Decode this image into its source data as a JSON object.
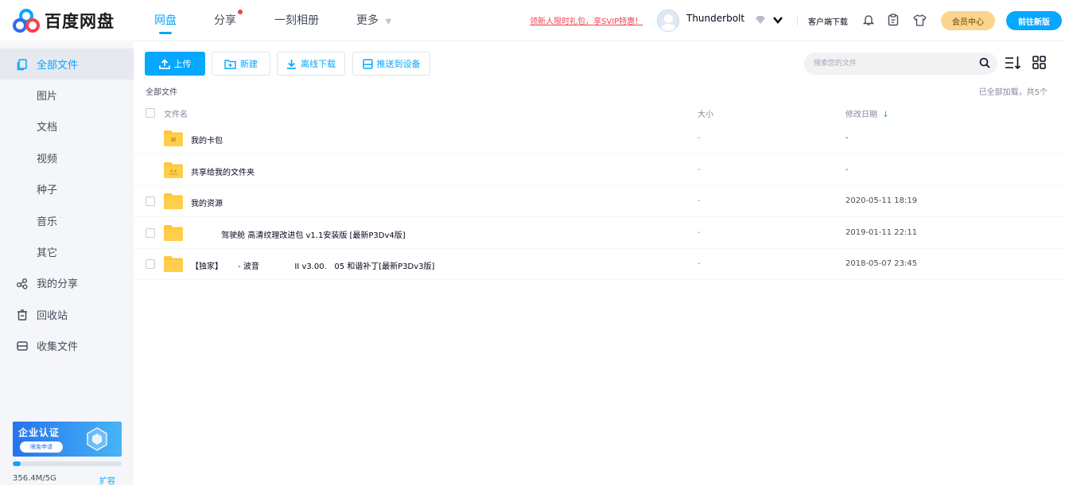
{
  "app": {
    "brand": "百度网盘",
    "nav_tabs": [
      {
        "label": "网盘",
        "active": true
      },
      {
        "label": "分享",
        "has_badge": true
      },
      {
        "label": "一刻相册"
      },
      {
        "label": "更多"
      }
    ],
    "promo_text": "领新人限时礼包，享SVIP特惠！",
    "username": "Thunderbolt",
    "client_download": "客户端下载",
    "vip_center": "会员中心",
    "new_version": "前往新版"
  },
  "sidebar": {
    "items": [
      {
        "label": "全部文件",
        "icon": "file-stack-icon",
        "active": true
      },
      {
        "label": "图片"
      },
      {
        "label": "文档"
      },
      {
        "label": "视频"
      },
      {
        "label": "种子"
      },
      {
        "label": "音乐"
      },
      {
        "label": "其它"
      },
      {
        "label": "我的分享",
        "icon": "share-icon"
      },
      {
        "label": "回收站",
        "icon": "trash-icon"
      },
      {
        "label": "收集文件",
        "icon": "collect-icon"
      }
    ],
    "enterprise": {
      "title": "企业认证",
      "apply": "限免申请"
    },
    "quota": {
      "used": "356.4M/5G",
      "fraction": 0.07,
      "expand": "扩容"
    }
  },
  "toolbar": {
    "upload": "上传",
    "new": "新建",
    "offline_download": "离线下载",
    "push_device": "推送到设备",
    "search_placeholder": "搜索您的文件"
  },
  "listing": {
    "breadcrumb": "全部文件",
    "loaded_status": "已全部加载，共5个",
    "columns": {
      "name": "文件名",
      "size": "大小",
      "date": "修改日期"
    },
    "rows": [
      {
        "name": "我的卡包",
        "size": "-",
        "date": "-",
        "folder_type": "card",
        "checkbox": false
      },
      {
        "name": "共享给我的文件夹",
        "size": "-",
        "date": "-",
        "folder_type": "shared",
        "checkbox": false
      },
      {
        "name": "我的资源",
        "size": "-",
        "date": "2020-05-11 18:19",
        "folder_type": "plain",
        "checkbox": true
      },
      {
        "name": "            驾驶舱 高清纹理改进包 v1.1安装版 [最新P3Dv4版]",
        "size": "-",
        "date": "2019-01-11 22:11",
        "folder_type": "plain",
        "checkbox": true
      },
      {
        "name": "【独家】      - 波音              II v3.00.   05 和谐补丁[最新P3Dv3版]",
        "size": "-",
        "date": "2018-05-07 23:45",
        "folder_type": "plain",
        "checkbox": true
      }
    ]
  },
  "colors": {
    "accent": "#06a7ff",
    "folder": "#ffc53d",
    "promo": "#f5424b"
  }
}
